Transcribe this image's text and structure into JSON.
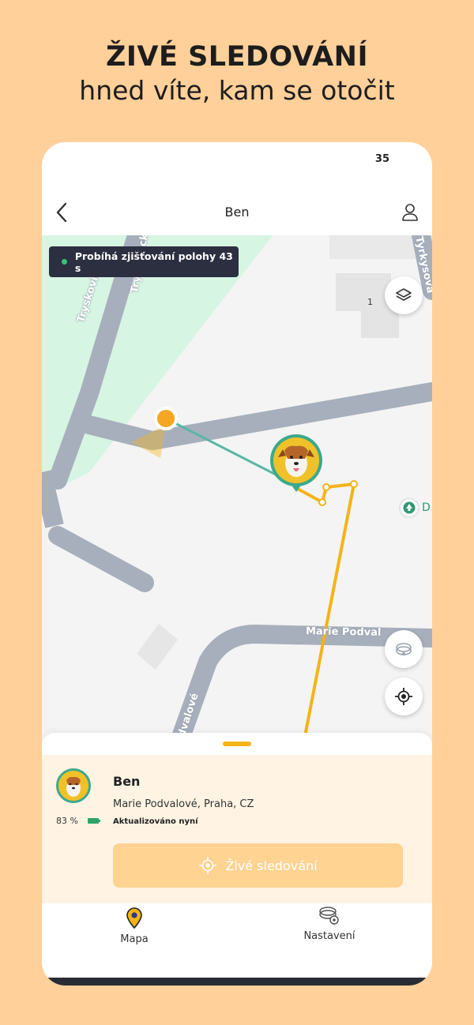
{
  "promo": {
    "title": "ŽIVÉ SLEDOVÁNÍ",
    "subtitle": "hned víte, kam se otočit"
  },
  "status_bar": {
    "time": "35"
  },
  "nav": {
    "title": "Ben",
    "back_icon": "chevron-left-icon",
    "profile_icon": "user-icon"
  },
  "map": {
    "locating_text": "Probíhá zjišťování polohy 43 s",
    "streets": {
      "tryskovicka": "Tryskovická",
      "top_vertical": "Tryskovická",
      "right_vertical": "Tyrkysová",
      "marie_horizontal": "Marie Podval",
      "marie_vertical": "Podvalové"
    },
    "building_number": "1",
    "poi_label": "D",
    "buttons": {
      "layers_icon": "layers-icon",
      "fence_icon": "geofence-icon",
      "center_icon": "crosshair-icon"
    },
    "colors": {
      "park": "#D6F5E3",
      "road": "#A7AFBC",
      "track_live": "#57B8A5",
      "track_history": "#F5B318",
      "owner_dot": "#F5A623"
    }
  },
  "pet_card": {
    "name": "Ben",
    "address": "Marie Podvalové, Praha, CZ",
    "updated": "Aktualizováno nyní",
    "battery": "83 %",
    "live_button": "Živé sledování"
  },
  "tabs": [
    {
      "label": "Mapa",
      "icon": "map-pin-icon"
    },
    {
      "label": "Nastavení",
      "icon": "settings-collar-icon"
    }
  ]
}
